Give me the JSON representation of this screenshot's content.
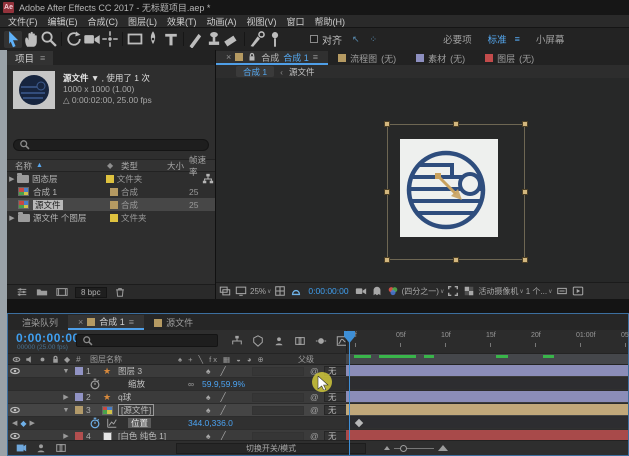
{
  "window": {
    "title": "Adobe After Effects CC 2017 - 无标题项目.aep *",
    "badge": "Ae"
  },
  "menu": {
    "items": [
      "文件(F)",
      "编辑(E)",
      "合成(C)",
      "图层(L)",
      "效果(T)",
      "动画(A)",
      "视图(V)",
      "窗口",
      "帮助(H)"
    ]
  },
  "toolbar": {
    "tools": [
      "selection",
      "hand",
      "zoom",
      "rotate",
      "camera",
      "pan-behind",
      "rectangle",
      "pen",
      "type",
      "brush",
      "clone-stamp",
      "eraser",
      "roto-brush",
      "puppet-pin"
    ],
    "active_tool": "selection",
    "snap_label": "对齐",
    "workspaces": [
      {
        "label": "必要项",
        "active": false
      },
      {
        "label": "标准",
        "active": true
      },
      {
        "label": "小屏幕",
        "active": false
      }
    ]
  },
  "project": {
    "tab": "项目",
    "preview": {
      "name": "源文件",
      "usage": "使用了 1 次",
      "dimensions": "1000 x 1000 (1.00)",
      "duration": "0:00:02:00, 25.00 fps"
    },
    "columns": {
      "name": "名称",
      "type": "类型",
      "size": "大小",
      "fps": "帧速率"
    },
    "rows": [
      {
        "kind": "folder",
        "name": "固态层",
        "type": "文件夹",
        "label_color": "#dec23f",
        "size": "",
        "fps": "",
        "network": true,
        "selected": false
      },
      {
        "kind": "comp",
        "name": "合成 1",
        "type": "合成",
        "label_color": "#b59a62",
        "size": "",
        "fps": "25",
        "network": false,
        "selected": false
      },
      {
        "kind": "comp",
        "name": "源文件",
        "type": "合成",
        "label_color": "#b59a62",
        "size": "",
        "fps": "25",
        "network": false,
        "selected": true
      },
      {
        "kind": "folder",
        "name": "源文件 个图层",
        "type": "文件夹",
        "label_color": "#dec23f",
        "size": "",
        "fps": "",
        "network": false,
        "selected": false
      }
    ],
    "footer": {
      "bpc": "8 bpc"
    }
  },
  "viewer": {
    "tabs": [
      {
        "label": "合成",
        "name": "合成 1",
        "swatch": "#b59a62",
        "active": true,
        "closable": true
      },
      {
        "label": "流程图",
        "name": "(无)",
        "swatch": "#b59a62",
        "active": false,
        "closable": false
      },
      {
        "label": "素材",
        "name": "(无)",
        "swatch": "#8d8fc0",
        "active": false,
        "closable": false
      },
      {
        "label": "图层",
        "name": "(无)",
        "swatch": "#c24b4b",
        "active": false,
        "closable": false
      }
    ],
    "breadcrumb": {
      "comp": "合成 1",
      "separator": "‹",
      "source": "源文件"
    },
    "bottom": {
      "zoom": "25%",
      "timecode": "0:00:00:00",
      "resolution": "(四分之一)",
      "view": "活动摄像机",
      "layout": "1 个..."
    }
  },
  "timeline": {
    "tabs": {
      "render_queue": "渲染队列",
      "comp": "合成 1",
      "source": "源文件"
    },
    "timecode": "0:00:00:00",
    "timecode_sub": "00000 (25.00 fps)",
    "columns": {
      "layer_name": "图层名称",
      "parent": "父级",
      "switches": "♠ + ╲ fx ▦ ◒ ◕ ⊕"
    },
    "layers": [
      {
        "num": "1",
        "name": "图层 3",
        "icon": "shape",
        "label_color": "#9193c4",
        "bar_color": "#8b8db8",
        "eye": true,
        "expanded": true,
        "selected": false,
        "parent": "无",
        "property": {
          "name": "缩放",
          "value": "59.9,59.9%",
          "link": true,
          "keyframe": false
        }
      },
      {
        "num": "2",
        "name": "q球",
        "icon": "shape",
        "label_color": "#9193c4",
        "bar_color": "#8b8db8",
        "eye": false,
        "expanded": false,
        "selected": false,
        "parent": "无"
      },
      {
        "num": "3",
        "name": "[源文件]",
        "icon": "comp",
        "label_color": "#b29a6a",
        "bar_color": "#c1a87a",
        "eye": true,
        "expanded": true,
        "selected": true,
        "parent": "无",
        "property": {
          "name": "位置",
          "value": "344.0,336.0",
          "link": false,
          "keyframe": true
        }
      },
      {
        "num": "4",
        "name": "[白色 纯色 1]",
        "icon": "solid",
        "label_color": "#b24f4f",
        "bar_color": "#a84a4a",
        "eye": true,
        "expanded": false,
        "selected": false,
        "parent": "无"
      }
    ],
    "ruler_labels": [
      "0f",
      "05f",
      "10f",
      "15f",
      "20f",
      "01:00f",
      "05f"
    ],
    "cache_segments": [
      [
        8,
        25
      ],
      [
        33,
        70
      ],
      [
        78,
        88
      ],
      [
        150,
        162
      ],
      [
        197,
        208
      ]
    ],
    "footer": {
      "toggle_label": "切换开关/模式"
    }
  }
}
